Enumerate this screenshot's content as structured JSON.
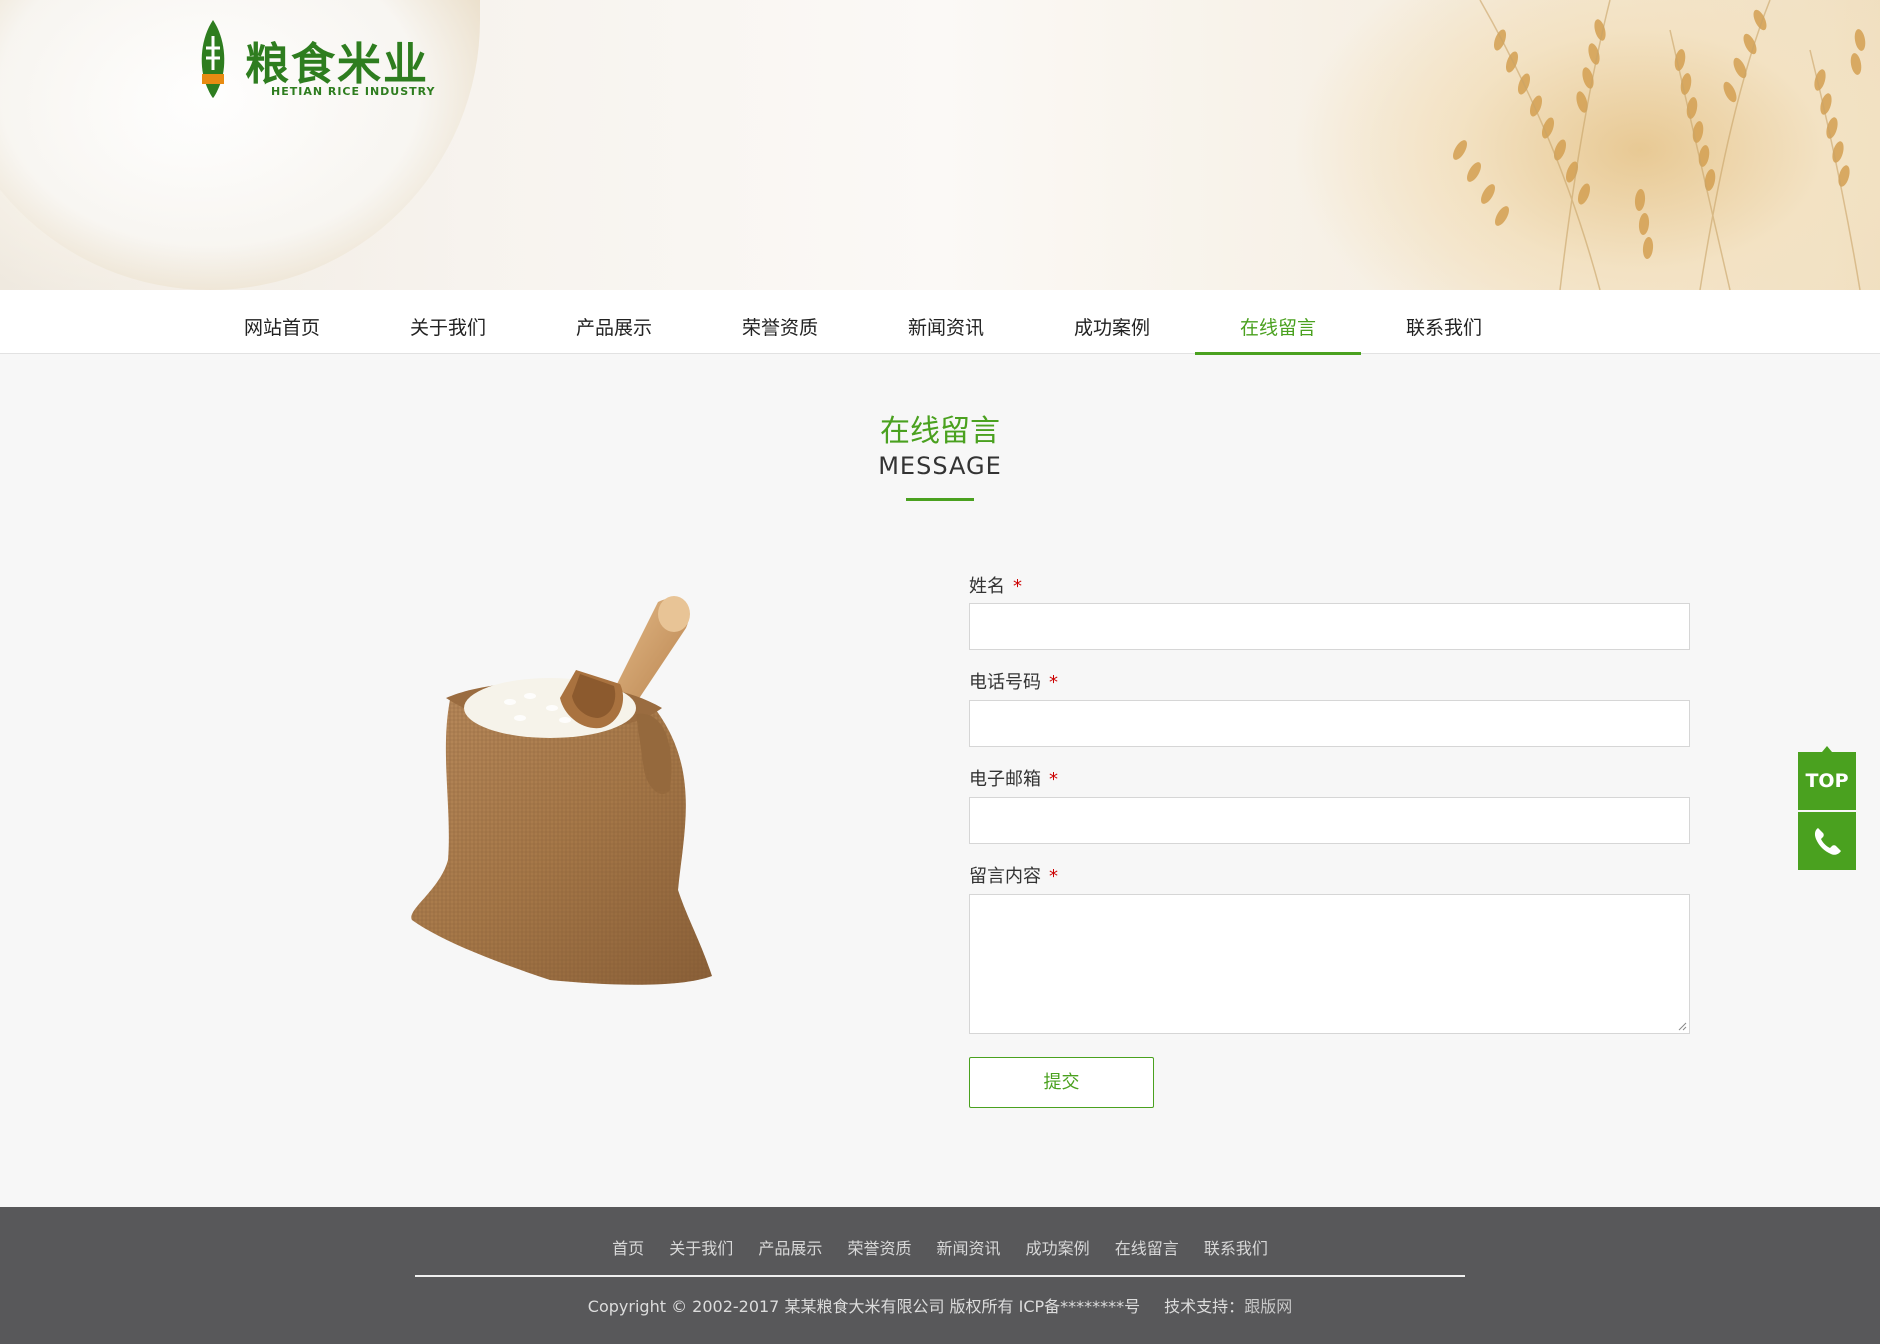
{
  "brand": {
    "logo_text": "粮食米业",
    "logo_sub": "HETIAN RICE INDUSTRY"
  },
  "nav": {
    "items": [
      {
        "label": "网站首页"
      },
      {
        "label": "关于我们"
      },
      {
        "label": "产品展示"
      },
      {
        "label": "荣誉资质"
      },
      {
        "label": "新闻资讯"
      },
      {
        "label": "成功案例"
      },
      {
        "label": "在线留言",
        "active": true
      },
      {
        "label": "联系我们"
      }
    ]
  },
  "section": {
    "title": "在线留言",
    "subtitle": "MESSAGE"
  },
  "form": {
    "required_mark": "*",
    "name_label": "姓名",
    "phone_label": "电话号码",
    "email_label": "电子邮箱",
    "content_label": "留言内容",
    "name_value": "",
    "phone_value": "",
    "email_value": "",
    "content_value": "",
    "submit_label": "提交"
  },
  "float": {
    "top_label": "TOP",
    "phone_icon": "phone-icon"
  },
  "footer": {
    "links": [
      "首页",
      "关于我们",
      "产品展示",
      "荣誉资质",
      "新闻资讯",
      "成功案例",
      "在线留言",
      "联系我们"
    ],
    "copyright": "Copyright © 2002-2017 某某粮食大米有限公司 版权所有 ICP备********号",
    "tech_label": "技术支持：",
    "tech_link": "跟版网"
  },
  "colors": {
    "accent": "#4aa11f",
    "footer_bg": "#58585a",
    "page_bg": "#f7f7f7"
  }
}
